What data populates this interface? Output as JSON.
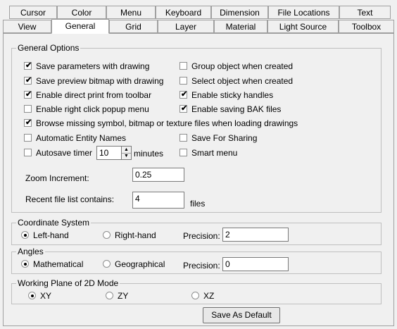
{
  "tabs_row1": [
    "Cursor",
    "Color",
    "Menu",
    "Keyboard",
    "Dimension",
    "File Locations",
    "Text"
  ],
  "tabs_row2": [
    "View",
    "General",
    "Grid",
    "Layer",
    "Material",
    "Light Source",
    "Toolbox"
  ],
  "general_options": {
    "title": "General Options",
    "left": [
      {
        "label": "Save parameters with drawing",
        "checked": true
      },
      {
        "label": "Save preview bitmap with drawing",
        "checked": true
      },
      {
        "label": "Enable direct print from toolbar",
        "checked": true
      },
      {
        "label": "Enable right click popup menu",
        "checked": false
      }
    ],
    "right": [
      {
        "label": "Group object when created",
        "checked": false
      },
      {
        "label": "Select object when created",
        "checked": false
      },
      {
        "label": "Enable sticky handles",
        "checked": true
      },
      {
        "label": "Enable saving BAK files",
        "checked": true
      }
    ],
    "browse_missing": {
      "label": "Browse missing symbol, bitmap or texture files when loading drawings",
      "checked": true
    },
    "auto_entity": {
      "label": "Automatic Entity Names",
      "checked": false
    },
    "save_sharing": {
      "label": "Save For Sharing",
      "checked": false
    },
    "autosave": {
      "label": "Autosave timer",
      "checked": false,
      "value": "10",
      "unit": "minutes"
    },
    "smart_menu": {
      "label": "Smart menu",
      "checked": false
    },
    "zoom_increment": {
      "label": "Zoom Increment:",
      "value": "0.25"
    },
    "recent_files": {
      "label": "Recent file list contains:",
      "value": "4",
      "unit": "files"
    }
  },
  "coordinate_system": {
    "title": "Coordinate System",
    "options": [
      "Left-hand",
      "Right-hand"
    ],
    "selected": "Left-hand",
    "precision_label": "Precision:",
    "precision_value": "2"
  },
  "angles": {
    "title": "Angles",
    "options": [
      "Mathematical",
      "Geographical"
    ],
    "selected": "Mathematical",
    "precision_label": "Precision:",
    "precision_value": "0"
  },
  "working_plane": {
    "title": "Working Plane of 2D Mode",
    "options": [
      "XY",
      "ZY",
      "XZ"
    ],
    "selected": "XY"
  },
  "save_default_label": "Save As Default"
}
